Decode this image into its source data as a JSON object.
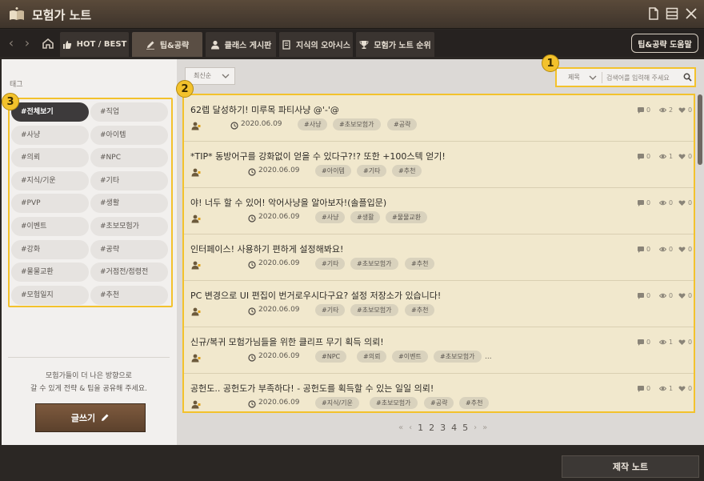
{
  "app": {
    "title": "모험가 노트"
  },
  "nav": {
    "tabs": [
      {
        "label": "HOT / BEST",
        "icon": "thumbs-up-icon"
      },
      {
        "label": "팁&공략",
        "icon": "pen-icon"
      },
      {
        "label": "클래스 게시판",
        "icon": "user-icon"
      },
      {
        "label": "지식의 오아시스",
        "icon": "book-icon"
      },
      {
        "label": "모험가 노트 순위",
        "icon": "trophy-icon"
      }
    ],
    "help_label": "팁&공략 도움말"
  },
  "sidebar": {
    "heading": "태그",
    "tags": [
      "#전체보기",
      "#직업",
      "#사냥",
      "#아이템",
      "#의뢰",
      "#NPC",
      "#지식/기운",
      "#기타",
      "#PVP",
      "#생활",
      "#이벤트",
      "#초보모험가",
      "#강화",
      "#공략",
      "#물물교환",
      "#거점전/점령전",
      "#모험일지",
      "#추천"
    ],
    "active_tag": "#전체보기",
    "message_line1": "모험가들이 더 나은 방향으로",
    "message_line2": "갈 수 있게 전략 & 팁을 공유해 주세요.",
    "write_label": "글쓰기"
  },
  "toolbar": {
    "sort_value": "최신순",
    "search_category": "제목",
    "search_placeholder": "검색어를 입력해 주세요"
  },
  "posts": [
    {
      "title": "62렙 달성하기! 미루목 파티사냥 @'-'@",
      "date": "2020.06.09",
      "tags": [
        "#사냥",
        "#초보모험가",
        "#공략"
      ],
      "comments": "0",
      "views": "2",
      "likes": "0"
    },
    {
      "title": "*TIP* 동방어구를 강화없이 얻을 수 있다구?!? 또한 +100스텍 얻기!",
      "date": "2020.06.09",
      "tags": [
        "#아이템",
        "#기타",
        "#추천"
      ],
      "comments": "0",
      "views": "1",
      "likes": "0"
    },
    {
      "title": "야! 너두 할 수 있어! 악어사냥을 알아보자!(솔플입문)",
      "date": "2020.06.09",
      "tags": [
        "#사냥",
        "#생활",
        "#물물교환"
      ],
      "comments": "0",
      "views": "0",
      "likes": "0"
    },
    {
      "title": "인터페이스! 사용하기 편하게 설정해봐요!",
      "date": "2020.06.09",
      "tags": [
        "#기타",
        "#초보모험가",
        "#추천"
      ],
      "comments": "0",
      "views": "0",
      "likes": "0"
    },
    {
      "title": "PC 변경으로 UI 편집이 번거로우시다구요? 설정 저장소가 있습니다!",
      "date": "2020.06.09",
      "tags": [
        "#기타",
        "#초보모험가",
        "#추천"
      ],
      "comments": "0",
      "views": "0",
      "likes": "0"
    },
    {
      "title": "신규/복귀 모험가님들을 위한 클리프 무기 획득 의뢰!",
      "date": "2020.06.09",
      "tags": [
        "#NPC",
        "#의뢰",
        "#이벤트",
        "#초보모험가"
      ],
      "more": "...",
      "comments": "0",
      "views": "1",
      "likes": "0"
    },
    {
      "title": "공헌도.. 공헌도가 부족하다! - 공헌도를 획득할 수 있는 일일 의뢰!",
      "date": "2020.06.09",
      "tags": [
        "#지식/기운",
        "#초보모험가",
        "#공략",
        "#추천"
      ],
      "comments": "0",
      "views": "1",
      "likes": "0"
    }
  ],
  "pagination": {
    "first": "«",
    "prev": "‹",
    "pages": [
      "1",
      "2",
      "3",
      "4",
      "5"
    ],
    "current": "1",
    "next": "›",
    "last": "»"
  },
  "footer": {
    "make_note_label": "제작 노트"
  },
  "badges": [
    "1",
    "2",
    "3"
  ],
  "colors": {
    "highlight": "#f3c22c",
    "active_tag": "#3d3a3b",
    "list_bg": "#f1e8cd",
    "titlebar": "#4a3d31"
  }
}
